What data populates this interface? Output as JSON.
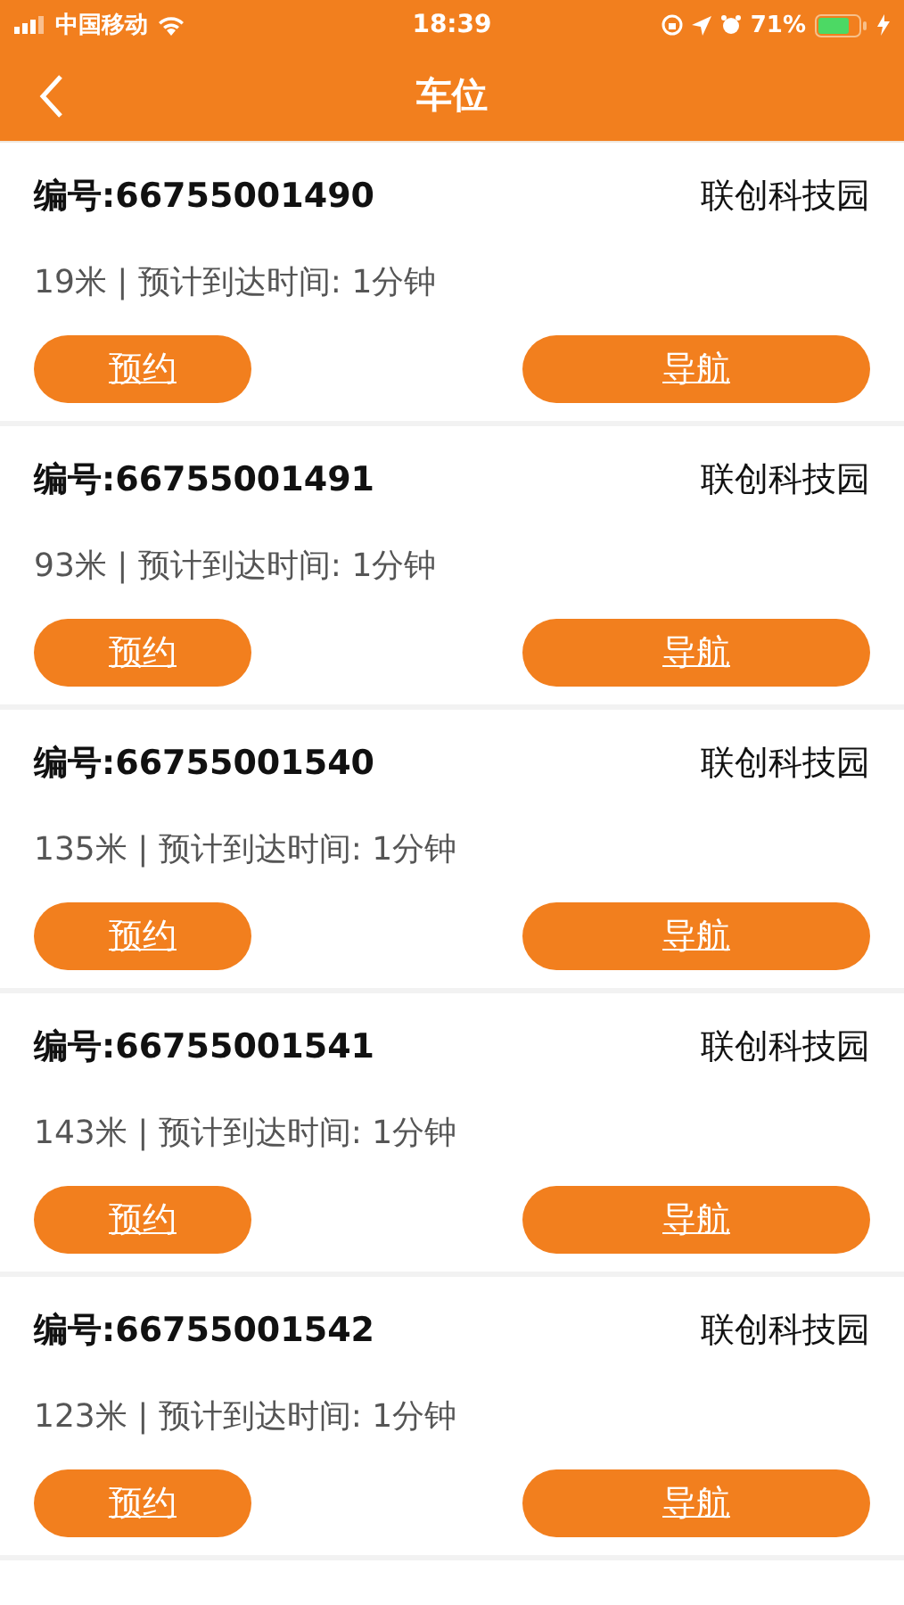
{
  "status_bar": {
    "carrier": "中国移动",
    "time": "18:39",
    "battery": "71%"
  },
  "nav": {
    "title": "车位"
  },
  "spots": [
    {
      "code": "编号:66755001490",
      "place": "联创科技园",
      "info": "19米 | 预计到达时间: 1分钟",
      "reserve": "预约",
      "navigate": "导航"
    },
    {
      "code": "编号:66755001491",
      "place": "联创科技园",
      "info": "93米 | 预计到达时间: 1分钟",
      "reserve": "预约",
      "navigate": "导航"
    },
    {
      "code": "编号:66755001540",
      "place": "联创科技园",
      "info": "135米 | 预计到达时间: 1分钟",
      "reserve": "预约",
      "navigate": "导航"
    },
    {
      "code": "编号:66755001541",
      "place": "联创科技园",
      "info": "143米 | 预计到达时间: 1分钟",
      "reserve": "预约",
      "navigate": "导航"
    },
    {
      "code": "编号:66755001542",
      "place": "联创科技园",
      "info": "123米 | 预计到达时间: 1分钟",
      "reserve": "预约",
      "navigate": "导航"
    }
  ]
}
